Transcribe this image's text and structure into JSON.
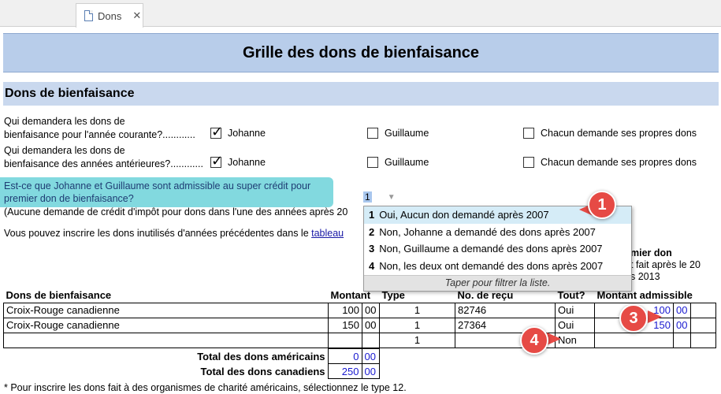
{
  "tab": {
    "label": "Dons",
    "icon": "document-icon",
    "close_icon": "close-icon"
  },
  "header": {
    "title": "Grille des dons de bienfaisance"
  },
  "section": {
    "title": "Dons de bienfaisance"
  },
  "questions": [
    {
      "label_line1": "Qui demandera les dons de",
      "label_line2": "bienfaisance pour l'année courante?............",
      "options": [
        {
          "label": "Johanne",
          "checked": true
        },
        {
          "label": "Guillaume",
          "checked": false
        },
        {
          "label": "Chacun demande ses propres dons",
          "checked": false
        }
      ]
    },
    {
      "label_line1": "Qui demandera les dons de",
      "label_line2": "bienfaisance des années antérieures?............",
      "options": [
        {
          "label": "Johanne",
          "checked": true
        },
        {
          "label": "Guillaume",
          "checked": false
        },
        {
          "label": "Chacun demande ses propres dons",
          "checked": false
        }
      ]
    }
  ],
  "super_credit": {
    "question_line1": "Est-ce que Johanne et Guillaume sont admissible au super crédit pour",
    "question_line2": "premier don de bienfaisance?",
    "value": "1",
    "note": "(Aucune demande de crédit d'impôt pour dons dans l'une des années après 20",
    "highlight_color": "#82d9df"
  },
  "unused_note": {
    "text": "Vous pouvez inscrire les dons inutilisés d'années précédentes dans le ",
    "link": "tableau"
  },
  "side_text": {
    "line1": "mier don",
    "line2": "t fait après le 20",
    "line3": "s 2013"
  },
  "dropdown": {
    "items": [
      {
        "num": "1",
        "label": "Oui, Aucun don demandé après 2007"
      },
      {
        "num": "2",
        "label": "Non, Johanne a demandé des dons après 2007"
      },
      {
        "num": "3",
        "label": "Non, Guillaume a demandé des dons après 2007"
      },
      {
        "num": "4",
        "label": "Non, les deux ont demandé des dons après 2007"
      }
    ],
    "footer": "Taper pour filtrer la liste."
  },
  "table": {
    "headers": {
      "name": "Dons de bienfaisance",
      "amount": "Montant",
      "type": "Type",
      "receipt": "No. de reçu",
      "all": "Tout?",
      "eligible": "Montant admissible"
    },
    "rows": [
      {
        "name": "Croix-Rouge canadienne",
        "amount": "100",
        "cents": "00",
        "type": "1",
        "receipt": "82746",
        "all": "Oui",
        "eligible": "100",
        "eligible_cents": "00"
      },
      {
        "name": "Croix-Rouge canadienne",
        "amount": "150",
        "cents": "00",
        "type": "1",
        "receipt": "27364",
        "all": "Oui",
        "eligible": "150",
        "eligible_cents": "00"
      },
      {
        "name": "",
        "amount": "",
        "cents": "",
        "type": "1",
        "receipt": "",
        "all": "Non",
        "eligible": "",
        "eligible_cents": ""
      }
    ]
  },
  "totals": {
    "us_label": "Total des dons américains",
    "us_amount": "0",
    "us_cents": "00",
    "ca_label": "Total des dons canadiens",
    "ca_amount": "250",
    "ca_cents": "00"
  },
  "footnote": "* Pour inscrire les dons fait à des organismes de charité américains, sélectionnez le type 12.",
  "callouts": [
    "1",
    "3",
    "4"
  ],
  "colors": {
    "title_band": "#b8cdea",
    "section_band": "#c9d8ee",
    "callout": "#e64a45",
    "link": "#1a1aa6"
  }
}
